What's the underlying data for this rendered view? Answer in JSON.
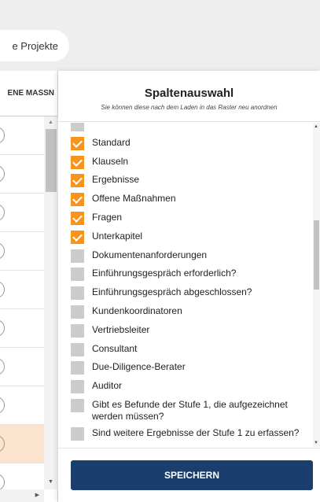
{
  "header": {
    "projects_label": "e Projekte"
  },
  "grid": {
    "column_header": "ENE MASSN"
  },
  "panel": {
    "title": "Spaltenauswahl",
    "subtitle": "Sie können diese nach dem Laden in das Raster neu anordnen",
    "items": [
      {
        "label": "",
        "checked": false
      },
      {
        "label": "Standard",
        "checked": true
      },
      {
        "label": "Klauseln",
        "checked": true
      },
      {
        "label": "Ergebnisse",
        "checked": true
      },
      {
        "label": "Offene Maßnahmen",
        "checked": true
      },
      {
        "label": "Fragen",
        "checked": true
      },
      {
        "label": "Unterkapitel",
        "checked": true
      },
      {
        "label": "Dokumentenanforderungen",
        "checked": false
      },
      {
        "label": "Einführungsgespräch erforderlich?",
        "checked": false
      },
      {
        "label": "Einführungsgespräch abgeschlossen?",
        "checked": false
      },
      {
        "label": "Kundenkoordinatoren",
        "checked": false
      },
      {
        "label": "Vertriebsleiter",
        "checked": false
      },
      {
        "label": "Consultant",
        "checked": false
      },
      {
        "label": "Due-Diligence-Berater",
        "checked": false
      },
      {
        "label": "Auditor",
        "checked": false
      },
      {
        "label": "Gibt es Befunde der Stufe 1, die aufgezeichnet werden müssen?",
        "checked": false
      },
      {
        "label": "Sind weitere Ergebnisse der Stufe 1 zu erfassen?",
        "checked": false
      }
    ],
    "save_label": "SPEICHERN"
  },
  "colors": {
    "accent_checked": "#f7941d",
    "unchecked": "#cccccc",
    "primary_button": "#1a3f6e",
    "row_highlight": "#fbe3cd"
  }
}
